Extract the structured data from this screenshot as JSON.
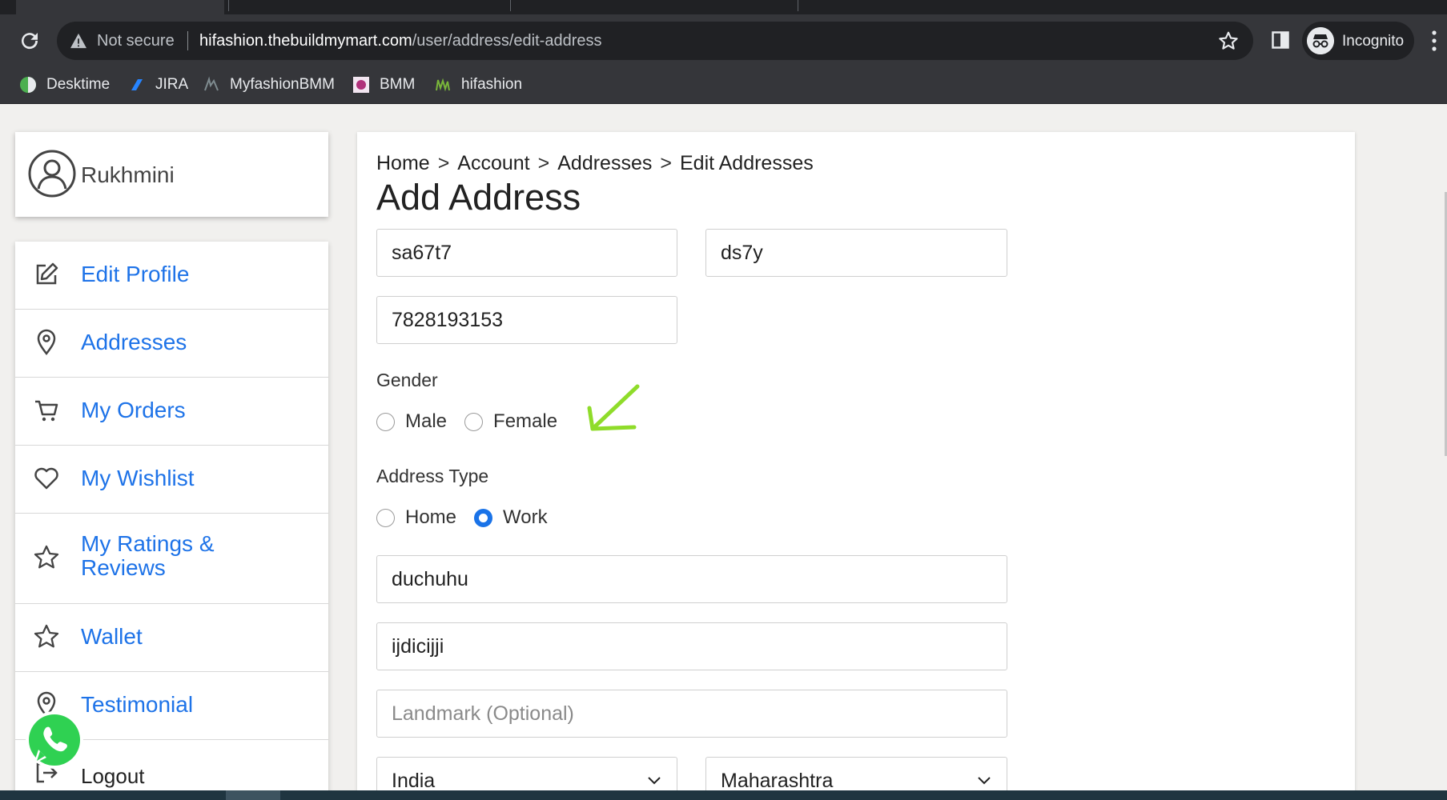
{
  "browser": {
    "security_label": "Not secure",
    "url_host": "hifashion.thebuildmymart.com",
    "url_path": "/user/address/edit-address",
    "incognito_label": "Incognito",
    "bookmarks": [
      {
        "label": "Desktime",
        "icon": "desktime-icon"
      },
      {
        "label": "JIRA",
        "icon": "jira-icon"
      },
      {
        "label": "MyfashionBMM",
        "icon": "myfashion-icon"
      },
      {
        "label": "BMM",
        "icon": "bmm-icon"
      },
      {
        "label": "hifashion",
        "icon": "hifashion-icon"
      }
    ]
  },
  "profile": {
    "name": "Rukhmini"
  },
  "menu": {
    "items": [
      {
        "label": "Edit Profile",
        "icon": "edit-icon"
      },
      {
        "label": "Addresses",
        "icon": "location-pin-icon"
      },
      {
        "label": "My Orders",
        "icon": "cart-icon"
      },
      {
        "label": "My Wishlist",
        "icon": "heart-icon"
      },
      {
        "label": "My Ratings & Reviews",
        "icon": "star-icon"
      },
      {
        "label": "Wallet",
        "icon": "star-icon"
      },
      {
        "label": "Testimonial",
        "icon": "location-pin-icon"
      },
      {
        "label": "Logout",
        "icon": "logout-icon"
      }
    ]
  },
  "breadcrumb": [
    "Home",
    "Account",
    "Addresses",
    "Edit Addresses"
  ],
  "breadcrumb_separator": ">",
  "form": {
    "title": "Add Address",
    "first_name": "sa67t7",
    "last_name": "ds7y",
    "phone": "7828193153",
    "gender_label": "Gender",
    "gender_options": [
      "Male",
      "Female"
    ],
    "gender_selected": "",
    "address_type_label": "Address Type",
    "address_type_options": [
      "Home",
      "Work"
    ],
    "address_type_selected": "Work",
    "address_line1": "duchuhu",
    "address_line2": "ijdicijji",
    "landmark_placeholder": "Landmark (Optional)",
    "country": "India",
    "state": "Maharashtra"
  },
  "colors": {
    "link_blue": "#1e73e8",
    "radio_checked": "#1a73e8",
    "annotation_arrow": "#8fdc2a"
  }
}
